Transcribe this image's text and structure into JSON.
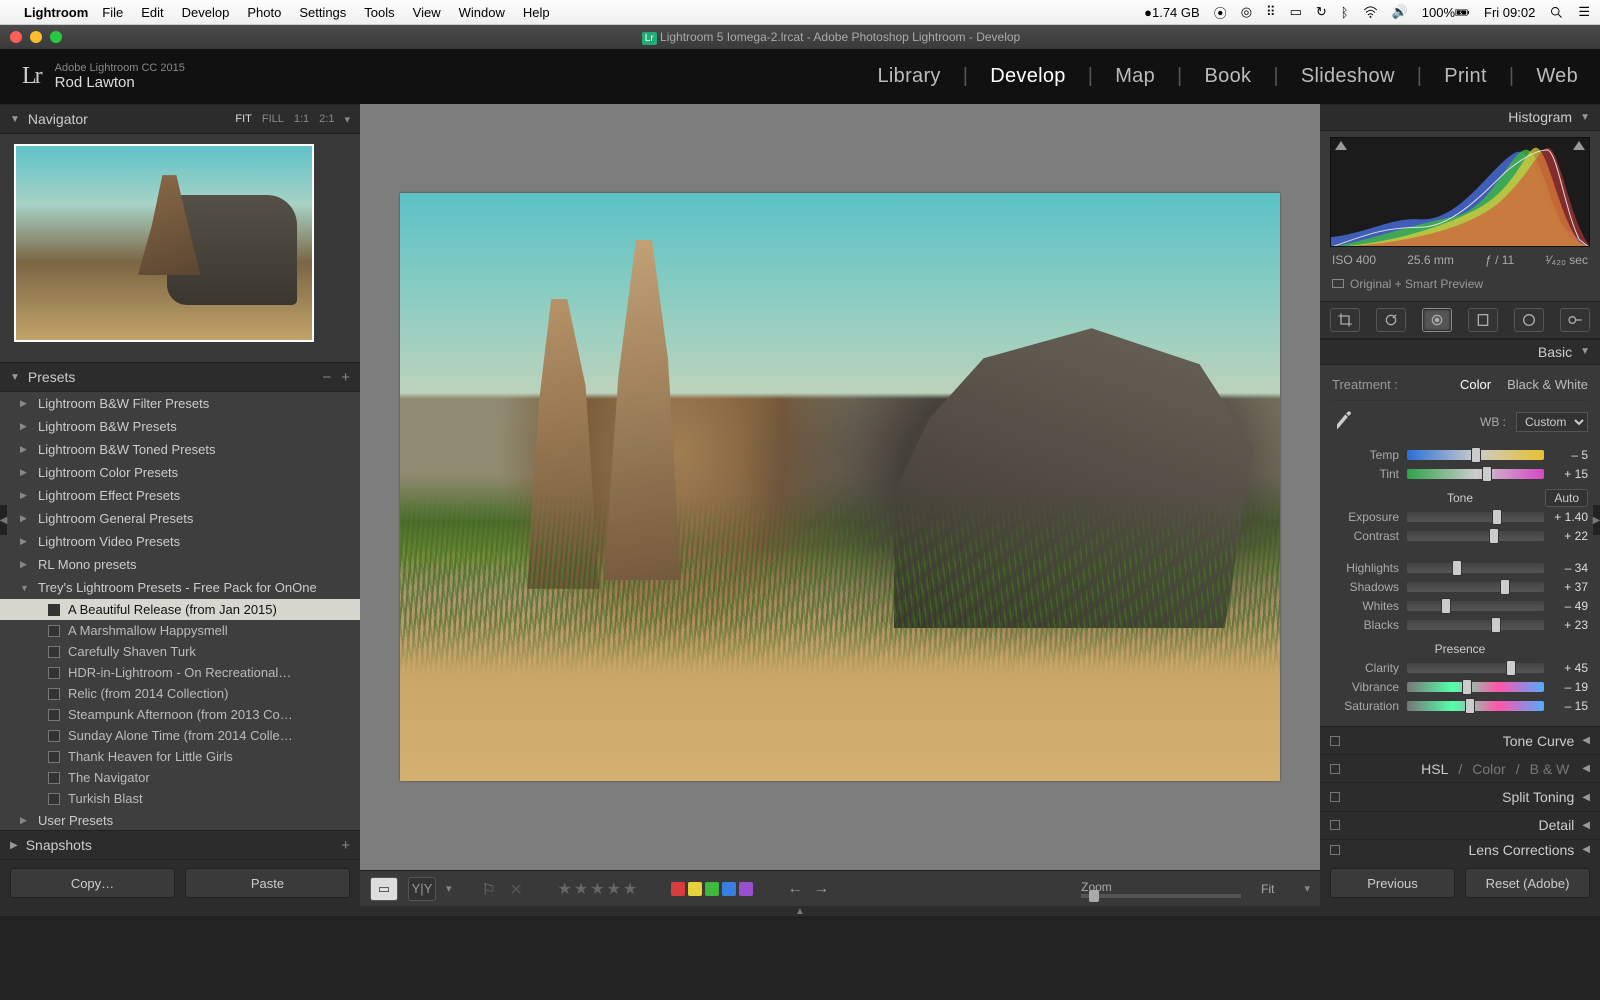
{
  "mac_menu": {
    "app": "Lightroom",
    "items": [
      "File",
      "Edit",
      "Develop",
      "Photo",
      "Settings",
      "Tools",
      "View",
      "Window",
      "Help"
    ],
    "right": {
      "mem": "1.74 GB",
      "battery": "100%",
      "clock": "Fri 09:02"
    }
  },
  "window_title": "Lightroom 5 Iomega-2.lrcat - Adobe Photoshop Lightroom - Develop",
  "identity": {
    "line1": "Adobe Lightroom CC 2015",
    "line2": "Rod Lawton"
  },
  "modules": [
    "Library",
    "Develop",
    "Map",
    "Book",
    "Slideshow",
    "Print",
    "Web"
  ],
  "active_module": "Develop",
  "navigator": {
    "title": "Navigator",
    "modes": [
      "FIT",
      "FILL",
      "1:1",
      "2:1"
    ]
  },
  "presets": {
    "title": "Presets",
    "folders": [
      {
        "name": "Lightroom B&W Filter Presets",
        "open": false
      },
      {
        "name": "Lightroom B&W Presets",
        "open": false
      },
      {
        "name": "Lightroom B&W Toned Presets",
        "open": false
      },
      {
        "name": "Lightroom Color Presets",
        "open": false
      },
      {
        "name": "Lightroom Effect Presets",
        "open": false
      },
      {
        "name": "Lightroom General Presets",
        "open": false
      },
      {
        "name": "Lightroom Video Presets",
        "open": false
      },
      {
        "name": "RL Mono presets",
        "open": false
      },
      {
        "name": "Trey's Lightroom Presets - Free Pack for OnOne",
        "open": true,
        "items": [
          {
            "name": "A Beautiful Release (from Jan 2015)",
            "selected": true
          },
          {
            "name": "A Marshmallow Happysmell"
          },
          {
            "name": "Carefully Shaven Turk"
          },
          {
            "name": "HDR-in-Lightroom - On Recreational…"
          },
          {
            "name": "Relic (from 2014 Collection)"
          },
          {
            "name": "Steampunk Afternoon (from 2013 Co…"
          },
          {
            "name": "Sunday Alone Time (from 2014 Colle…"
          },
          {
            "name": "Thank Heaven for Little Girls"
          },
          {
            "name": "The Navigator"
          },
          {
            "name": "Turkish Blast"
          }
        ]
      },
      {
        "name": "User Presets",
        "open": false
      }
    ]
  },
  "snapshots": {
    "title": "Snapshots"
  },
  "left_buttons": {
    "copy": "Copy…",
    "paste": "Paste"
  },
  "histogram": {
    "title": "Histogram",
    "exif": {
      "iso": "ISO 400",
      "focal": "25.6 mm",
      "aperture": "ƒ / 11",
      "shutter": "¹⁄₄₂₀ sec"
    },
    "preview": "Original + Smart Preview"
  },
  "basic": {
    "title": "Basic",
    "treatment_label": "Treatment :",
    "treatment_color": "Color",
    "treatment_bw": "Black & White",
    "wb_label": "WB :",
    "wb_value": "Custom",
    "temp_label": "Temp",
    "temp_val": "– 5",
    "tint_label": "Tint",
    "tint_val": "+ 15",
    "tone_title": "Tone",
    "auto": "Auto",
    "exposure_label": "Exposure",
    "exposure_val": "+ 1.40",
    "contrast_label": "Contrast",
    "contrast_val": "+ 22",
    "highlights_label": "Highlights",
    "highlights_val": "– 34",
    "shadows_label": "Shadows",
    "shadows_val": "+ 37",
    "whites_label": "Whites",
    "whites_val": "– 49",
    "blacks_label": "Blacks",
    "blacks_val": "+ 23",
    "presence_title": "Presence",
    "clarity_label": "Clarity",
    "clarity_val": "+ 45",
    "vibrance_label": "Vibrance",
    "vibrance_val": "– 19",
    "saturation_label": "Saturation",
    "saturation_val": "– 15"
  },
  "collapsed_panels": {
    "tone_curve": "Tone Curve",
    "hsl": "HSL",
    "color": "Color",
    "bw": "B & W",
    "split_toning": "Split Toning",
    "detail": "Detail",
    "lens": "Lens Corrections"
  },
  "right_buttons": {
    "previous": "Previous",
    "reset": "Reset (Adobe)"
  },
  "toolbar": {
    "zoom_label": "Zoom",
    "fit_label": "Fit",
    "colors": [
      "#d73d3d",
      "#e8d23a",
      "#3fba3f",
      "#3a7fe0",
      "#9a4fd1"
    ]
  }
}
